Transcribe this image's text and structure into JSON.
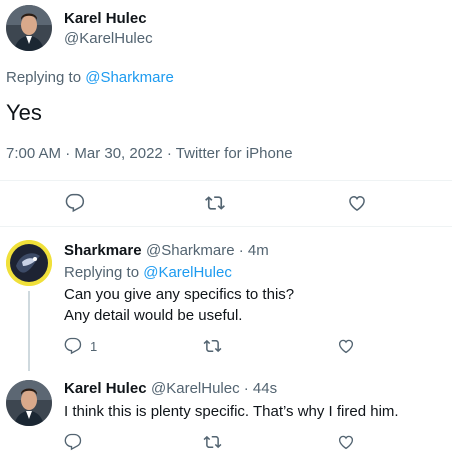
{
  "main_tweet": {
    "author_name": "Karel Hulec",
    "author_handle": "@KarelHulec",
    "replying_prefix": "Replying to",
    "replying_handle": "@Sharkmare",
    "text": "Yes",
    "meta": "7:00 AM · Mar 30, 2022 · Twitter for iPhone"
  },
  "replies": [
    {
      "author_name": "Sharkmare",
      "author_handle": "@Sharkmare · 4m",
      "replying_prefix": "Replying to",
      "replying_handle": "@KarelHulec",
      "text_line1": "Can you give any specifics to this?",
      "text_line2": "Any detail would be useful.",
      "reply_count": "1"
    },
    {
      "author_name": "Karel Hulec",
      "author_handle": "@KarelHulec · 44s",
      "text_line1": "I think this is plenty specific. That’s why I fired him."
    }
  ],
  "icons": {
    "reply": "reply-icon",
    "retweet": "retweet-icon",
    "like": "like-icon"
  }
}
